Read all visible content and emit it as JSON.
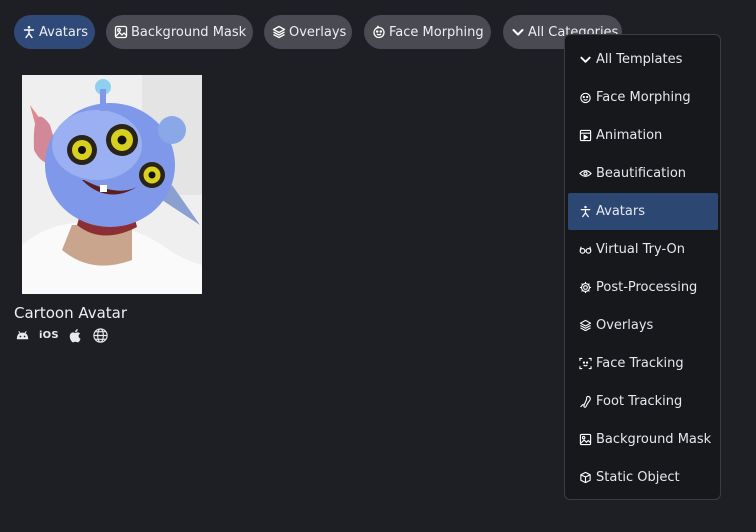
{
  "filters": {
    "chips": [
      {
        "label": "Avatars",
        "icon": "person-icon",
        "active": true
      },
      {
        "label": "Background Mask",
        "icon": "image-icon",
        "active": false
      },
      {
        "label": "Overlays",
        "icon": "layers-icon",
        "active": false
      },
      {
        "label": "Face Morphing",
        "icon": "face-icon",
        "active": false
      }
    ],
    "category_dropdown_label": "All Categories"
  },
  "templates": [
    {
      "title": "Cartoon Avatar",
      "platforms": [
        "android",
        "iOS",
        "apple",
        "web"
      ],
      "ios_label": "iOS"
    }
  ],
  "category_menu": {
    "selected": "Avatars",
    "items": [
      {
        "label": "All Templates",
        "icon": "chevron-down-icon"
      },
      {
        "label": "Face Morphing",
        "icon": "face-icon"
      },
      {
        "label": "Animation",
        "icon": "animation-icon"
      },
      {
        "label": "Beautification",
        "icon": "eye-icon"
      },
      {
        "label": "Avatars",
        "icon": "person-icon"
      },
      {
        "label": "Virtual Try-On",
        "icon": "glasses-icon"
      },
      {
        "label": "Post-Processing",
        "icon": "gear-icon"
      },
      {
        "label": "Overlays",
        "icon": "layers-icon"
      },
      {
        "label": "Face Tracking",
        "icon": "face-scan-icon"
      },
      {
        "label": "Foot Tracking",
        "icon": "foot-icon"
      },
      {
        "label": "Background Mask",
        "icon": "image-icon"
      },
      {
        "label": "Static Object",
        "icon": "cube-icon"
      }
    ]
  },
  "colors": {
    "background": "#1e1f24",
    "chip": "#4a4b52",
    "chip_active": "#2f4a78",
    "menu_selected": "#2c4771"
  }
}
